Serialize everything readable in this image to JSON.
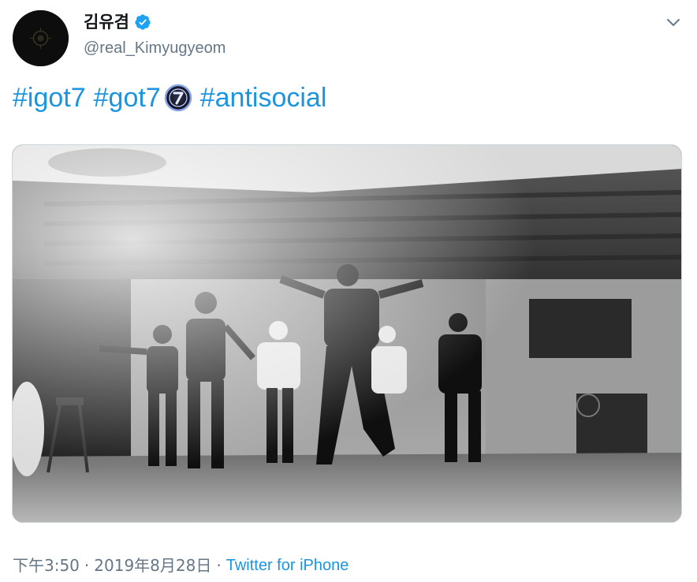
{
  "tweet": {
    "display_name": "김유겸",
    "handle": "@real_Kimyugyeom",
    "verified": true,
    "hashtags": [
      "#igot7",
      "#got7",
      "#antisocial"
    ],
    "time": "下午3:50",
    "separator": "·",
    "date": "2019年8月28日",
    "source": "Twitter for iPhone"
  },
  "icons": {
    "verified": "verified-badge-icon",
    "caret": "chevron-down-icon",
    "emoji": "got7-emoji-icon"
  },
  "colors": {
    "link": "#1b95e0",
    "secondary_text": "#657786",
    "verified": "#1da1f2"
  }
}
